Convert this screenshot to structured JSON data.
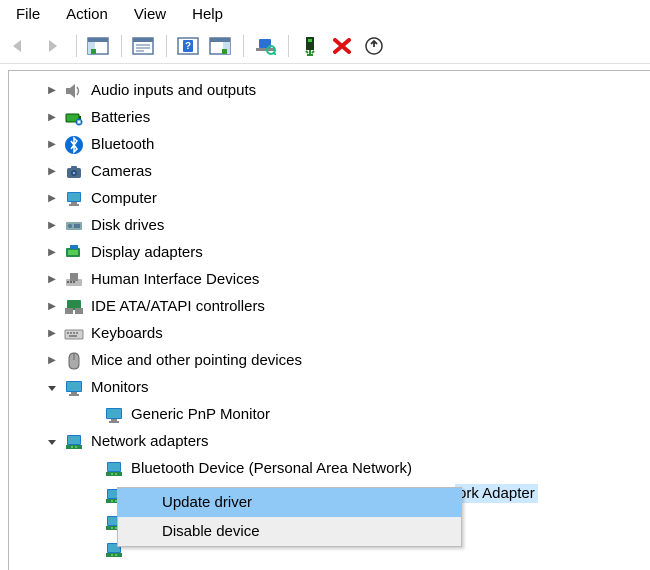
{
  "menubar": {
    "file": "File",
    "action": "Action",
    "view": "View",
    "help": "Help"
  },
  "tree": {
    "audio": "Audio inputs and outputs",
    "batteries": "Batteries",
    "bluetooth": "Bluetooth",
    "cameras": "Cameras",
    "computer": "Computer",
    "diskdrives": "Disk drives",
    "display": "Display adapters",
    "hid": "Human Interface Devices",
    "ide": "IDE ATA/ATAPI controllers",
    "keyboards": "Keyboards",
    "mice": "Mice and other pointing devices",
    "monitors": "Monitors",
    "monitors_child": "Generic PnP Monitor",
    "network": "Network adapters",
    "network_child1": "Bluetooth Device (Personal Area Network)",
    "network_child2_suffix": "ork Adapter"
  },
  "context_menu": {
    "update": "Update driver",
    "disable": "Disable device"
  }
}
